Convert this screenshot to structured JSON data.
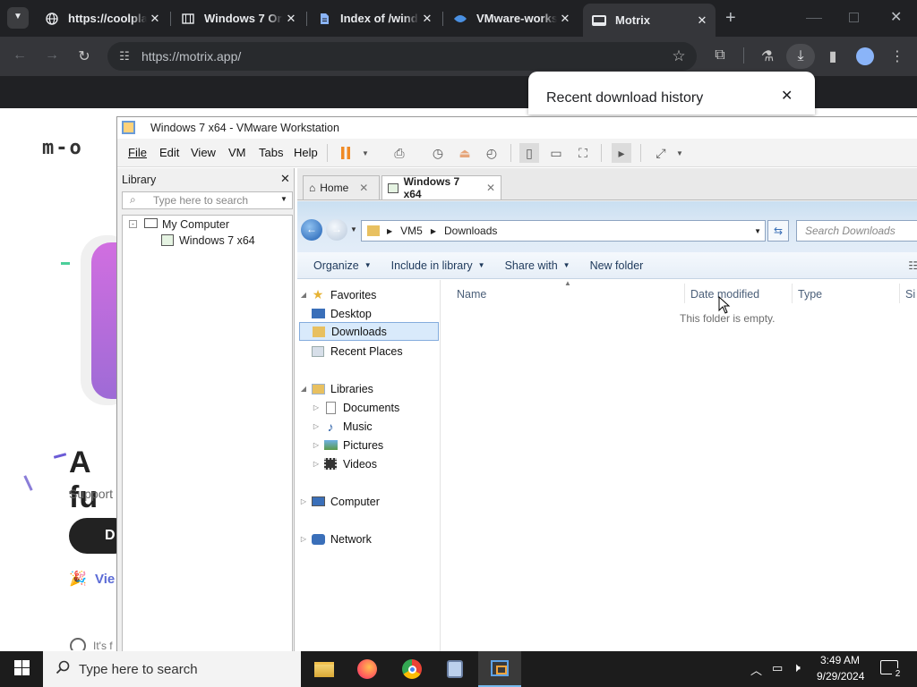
{
  "browser": {
    "tabs": [
      {
        "title": "https://coolpla",
        "icon": "globe-icon"
      },
      {
        "title": "Windows 7 Ori",
        "icon": "archive-icon"
      },
      {
        "title": "Index of /wind",
        "icon": "document-icon"
      },
      {
        "title": "VMware-works",
        "icon": "vmware-icon"
      },
      {
        "title": "Motrix",
        "icon": "motrix-icon"
      }
    ],
    "url": "https://motrix.app/",
    "download_popup_title": "Recent download history"
  },
  "website": {
    "logo": "m-o",
    "headline": "A fu",
    "support": "Support",
    "button": "D",
    "view": "Vie",
    "footer": "It's f"
  },
  "vmware": {
    "title": "Windows 7 x64 - VMware Workstation",
    "menu": [
      "File",
      "Edit",
      "View",
      "VM",
      "Tabs",
      "Help"
    ],
    "library_title": "Library",
    "library_search_placeholder": "Type here to search",
    "tree": {
      "root": "My Computer",
      "child": "Windows 7 x64"
    },
    "tabs": [
      "Home",
      "Windows 7 x64"
    ]
  },
  "explorer": {
    "breadcrumb": [
      "VM5",
      "Downloads"
    ],
    "search_placeholder": "Search Downloads",
    "commands": [
      "Organize",
      "Include in library",
      "Share with",
      "New folder"
    ],
    "nav": {
      "favorites": "Favorites",
      "favorites_items": [
        "Desktop",
        "Downloads",
        "Recent Places"
      ],
      "libraries": "Libraries",
      "libraries_items": [
        "Documents",
        "Music",
        "Pictures",
        "Videos"
      ],
      "computer": "Computer",
      "network": "Network"
    },
    "columns": [
      "Name",
      "Date modified",
      "Type",
      "Si"
    ],
    "empty_message": "This folder is empty."
  },
  "taskbar": {
    "search_placeholder": "Type here to search",
    "time": "3:49 AM",
    "date": "9/29/2024",
    "notification_count": "2"
  }
}
